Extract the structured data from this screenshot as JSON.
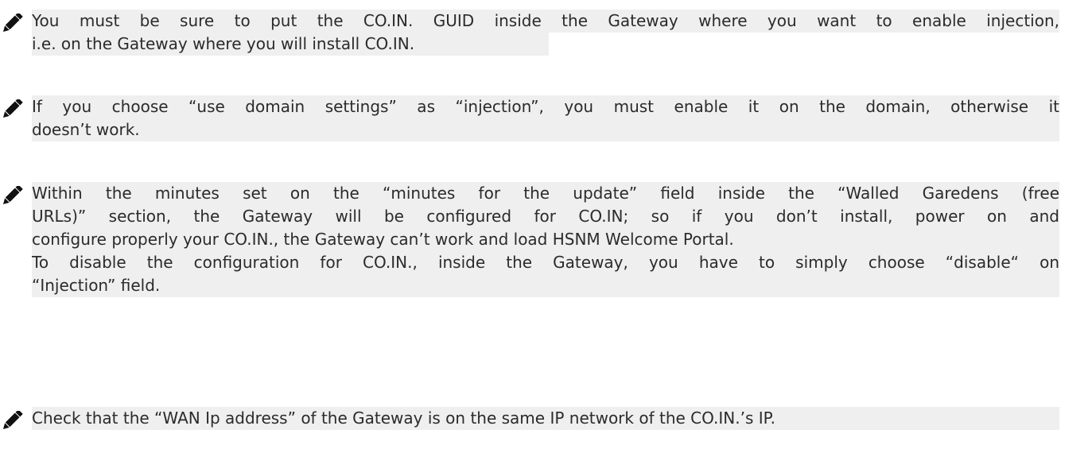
{
  "notes": [
    {
      "icon": "pencil-icon",
      "lines": [
        "You must be sure to put the CO.IN. GUID inside the Gateway where you want to enable injection,",
        "i.e. on the Gateway where you will install CO.IN."
      ]
    },
    {
      "icon": "pencil-icon",
      "lines": [
        "If you choose “use domain settings” as “injection”, you must enable it on the domain, otherwise it",
        "doesn’t work."
      ]
    },
    {
      "icon": "pencil-icon",
      "lines": [
        "Within the minutes set on the “minutes for the update” field inside the “Walled Garedens (free",
        "URLs)” section, the Gateway will be configured for CO.IN; so if you don’t install, power on and",
        "configure properly your CO.IN., the Gateway can’t work and load HSNM Welcome Portal.",
        "To disable the configuration for CO.IN., inside the Gateway, you have to simply choose “disable“ on",
        "“Injection” field."
      ]
    },
    {
      "icon": "pencil-icon",
      "lines": [
        "Check that the “WAN Ip address” of the Gateway is on the same IP network of the CO.IN.’s IP."
      ]
    }
  ]
}
